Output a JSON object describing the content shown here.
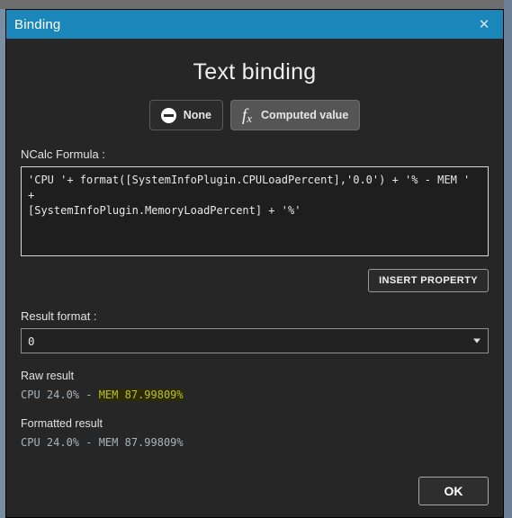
{
  "window": {
    "title": "Binding",
    "close_icon": "close-icon",
    "close_label": "✕"
  },
  "dialog": {
    "heading": "Text binding",
    "mode_buttons": [
      {
        "label": "None",
        "icon": "no-entry-icon",
        "selected": false
      },
      {
        "label": "Computed value",
        "icon": "fx-icon",
        "selected": true
      }
    ],
    "formula": {
      "label": "NCalc Formula :",
      "value": "'CPU '+ format([SystemInfoPlugin.CPULoadPercent],'0.0') + '% - MEM ' +\n[SystemInfoPlugin.MemoryLoadPercent] + '%'",
      "placeholder": ""
    },
    "insert_property_button": "INSERT PROPERTY",
    "result_format": {
      "label": "Result format :",
      "value": "0",
      "chevron_icon": "chevron-down-icon"
    },
    "raw_result": {
      "heading": "Raw result",
      "prefix": "CPU 24.0% - ",
      "highlighted": "MEM 87.99809%"
    },
    "formatted_result": {
      "heading": "Formatted result",
      "value": "CPU 24.0% - MEM 87.99809%"
    },
    "ok_button": "OK"
  },
  "colors": {
    "titlebar": "#1b86ba",
    "dialog_background": "#262626",
    "selected_toggle": "#555555",
    "highlight_background": "#2e2a08",
    "highlight_text": "#b5c32b"
  }
}
